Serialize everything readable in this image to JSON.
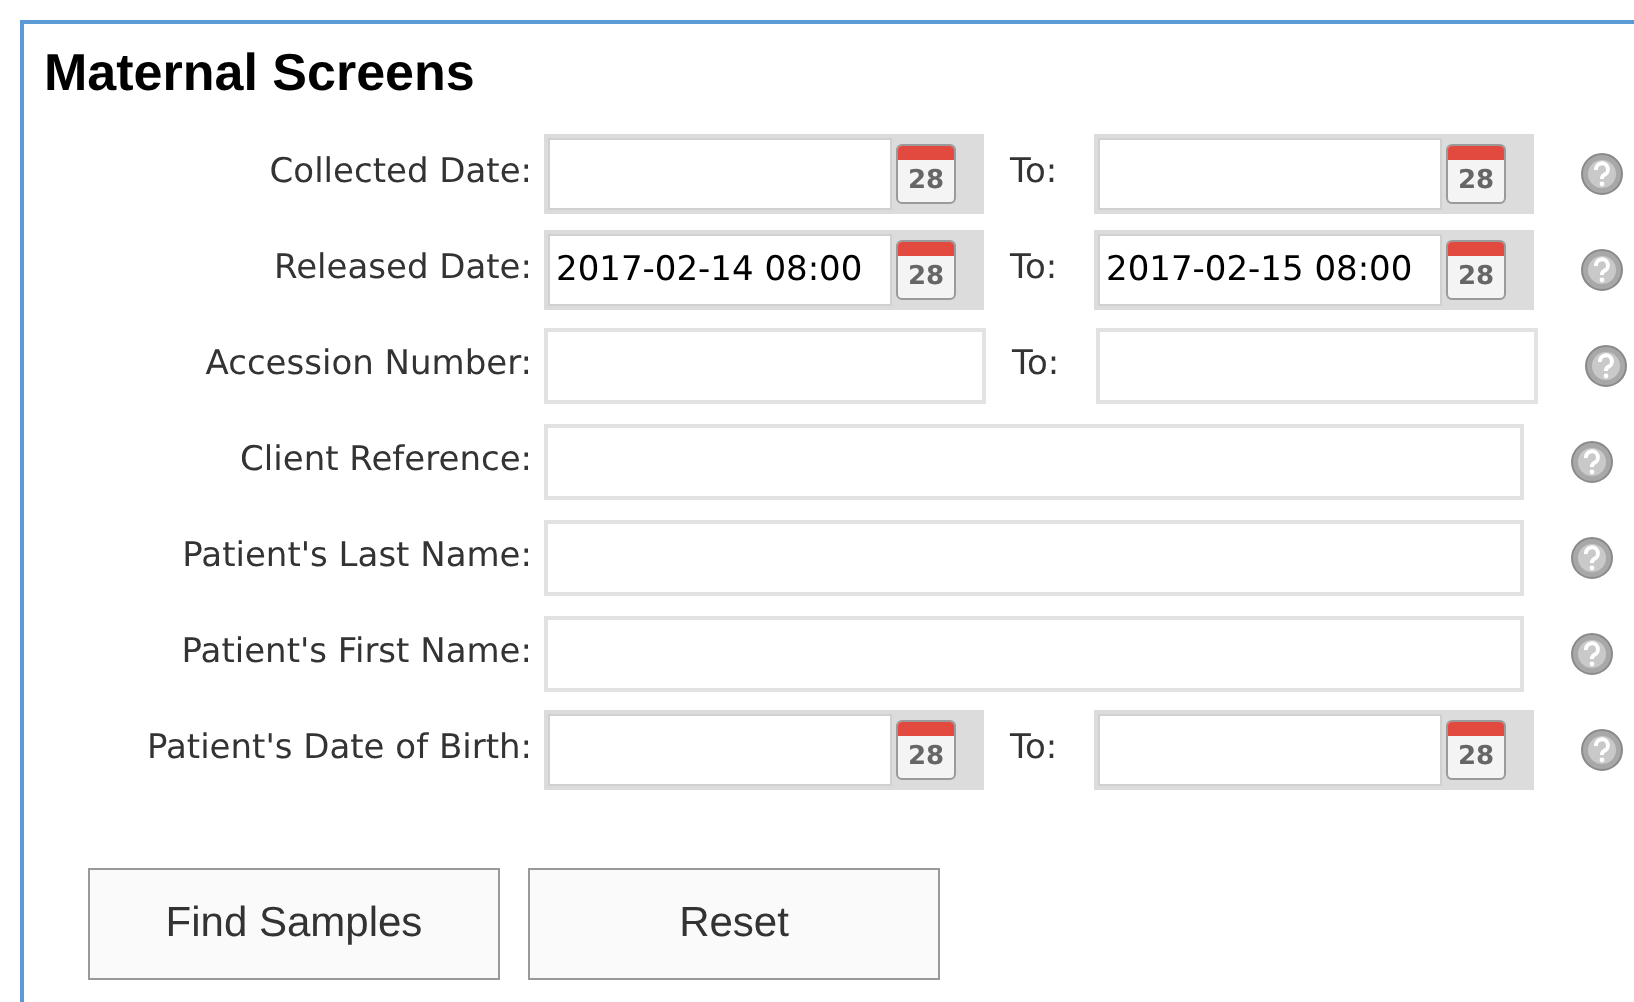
{
  "title": "Maternal Screens",
  "rows": [
    {
      "kind": "date_range",
      "label": "Collected Date:",
      "from": {
        "calendar_text": "28"
      },
      "to_label": "To:",
      "to": {
        "calendar_text": "28"
      }
    },
    {
      "kind": "date_range",
      "label": "Released Date:",
      "from": {
        "value": "2017-02-14 08:00",
        "calendar_text": "28"
      },
      "to_label": "To:",
      "to": {
        "value": "2017-02-15 08:00",
        "calendar_text": "28"
      }
    },
    {
      "kind": "text_range",
      "label": "Accession Number:",
      "from": {},
      "to_label": "To:",
      "to": {}
    },
    {
      "kind": "text",
      "label": "Client Reference:",
      "from": {}
    },
    {
      "kind": "text",
      "label": "Patient's Last Name:",
      "from": {}
    },
    {
      "kind": "text",
      "label": "Patient's First Name:",
      "from": {}
    },
    {
      "kind": "date_range",
      "label": "Patient's Date of Birth:",
      "from": {
        "calendar_text": "28"
      },
      "to_label": "To:",
      "to": {
        "calendar_text": "28"
      }
    }
  ],
  "buttons": [
    "Find Samples",
    "Reset"
  ]
}
